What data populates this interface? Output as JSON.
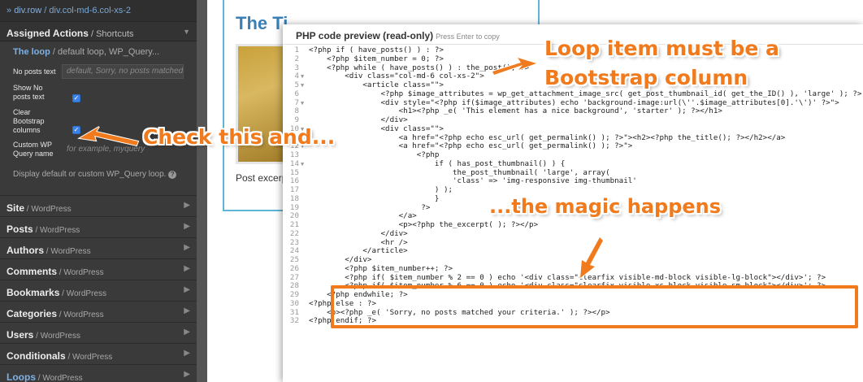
{
  "breadcrumb": {
    "prefix": "» ",
    "crumb1": "div.row",
    "sep": " / ",
    "crumb2": "div.col-md-6.col-xs-2"
  },
  "assigned": {
    "title": "Assigned Actions",
    "subtitle": " / Shortcuts",
    "loop_label": "The loop",
    "loop_desc": " / default loop, WP_Query...",
    "fields": [
      {
        "label": "No posts text",
        "placeholder": "default, Sorry, no posts matched y"
      },
      {
        "label": "Show No posts text",
        "checked": true
      },
      {
        "label": "Clear Bootstrap columns",
        "checked": true
      },
      {
        "label": "Custom WP Query name",
        "placeholder": "for example, myquery"
      }
    ],
    "note": "Display default or custom WP_Query loop.",
    "help_icon": "help-circle-icon"
  },
  "sections": [
    {
      "name": "Site",
      "cat": " / WordPress"
    },
    {
      "name": "Posts",
      "cat": " / WordPress"
    },
    {
      "name": "Authors",
      "cat": " / WordPress"
    },
    {
      "name": "Comments",
      "cat": " / WordPress"
    },
    {
      "name": "Bookmarks",
      "cat": " / WordPress"
    },
    {
      "name": "Categories",
      "cat": " / WordPress"
    },
    {
      "name": "Users",
      "cat": " / WordPress"
    },
    {
      "name": "Conditionals",
      "cat": " / WordPress"
    },
    {
      "name": "Loops",
      "cat": " / WordPress"
    }
  ],
  "background": {
    "title": "The Ti",
    "excerpt": "Post excerpt"
  },
  "dialog": {
    "title": "PHP code preview (read-only)",
    "hint": "Press Enter to copy"
  },
  "code_lines": [
    {
      "n": "1",
      "fold": "",
      "t": "<?php if ( have_posts() ) : ?>"
    },
    {
      "n": "2",
      "fold": "",
      "t": "    <?php $item_number = 0; ?>"
    },
    {
      "n": "3",
      "fold": "",
      "t": "    <?php while ( have_posts() ) : the_post(); ?>"
    },
    {
      "n": "4",
      "fold": "▼",
      "t": "        <div class=\"col-md-6 col-xs-2\">"
    },
    {
      "n": "5",
      "fold": "▼",
      "t": "            <article class=\"\">"
    },
    {
      "n": "6",
      "fold": "",
      "t": "                <?php $image_attributes = wp_get_attachment_image_src( get_post_thumbnail_id( get_the_ID() ), 'large' ); ?>"
    },
    {
      "n": "7",
      "fold": "▼",
      "t": "                <div style=\"<?php if($image_attributes) echo 'background-image:url(\\''.$image_attributes[0].'\\')' ?>\">"
    },
    {
      "n": "8",
      "fold": "",
      "t": "                    <h1><?php _e( 'This element has a nice background', 'starter' ); ?></h1>"
    },
    {
      "n": "9",
      "fold": "",
      "t": "                </div>"
    },
    {
      "n": "10",
      "fold": "▼",
      "t": "                <div class=\"\">"
    },
    {
      "n": "11",
      "fold": "",
      "t": "                    <a href=\"<?php echo esc_url( get_permalink() ); ?>\"><h2><?php the_title(); ?></h2></a>"
    },
    {
      "n": "12",
      "fold": "▼",
      "t": "                    <a href=\"<?php echo esc_url( get_permalink() ); ?>\">"
    },
    {
      "n": "13",
      "fold": "",
      "t": "                        <?php"
    },
    {
      "n": "14",
      "fold": "▼",
      "t": "                            if ( has_post_thumbnail() ) {"
    },
    {
      "n": "15",
      "fold": "",
      "t": "                                the_post_thumbnail( 'large', array("
    },
    {
      "n": "16",
      "fold": "",
      "t": "                                'class' => 'img-responsive img-thumbnail'"
    },
    {
      "n": "17",
      "fold": "",
      "t": "                            ) );"
    },
    {
      "n": "18",
      "fold": "",
      "t": "                            }"
    },
    {
      "n": "19",
      "fold": "",
      "t": "                         ?>"
    },
    {
      "n": "20",
      "fold": "",
      "t": "                    </a>"
    },
    {
      "n": "21",
      "fold": "",
      "t": "                    <p><?php the_excerpt( ); ?></p>"
    },
    {
      "n": "22",
      "fold": "",
      "t": "                </div>"
    },
    {
      "n": "23",
      "fold": "",
      "t": "                <hr />"
    },
    {
      "n": "24",
      "fold": "",
      "t": "            </article>"
    },
    {
      "n": "25",
      "fold": "",
      "t": "        </div>"
    },
    {
      "n": "26",
      "fold": "",
      "t": "        <?php $item_number++; ?>"
    },
    {
      "n": "27",
      "fold": "",
      "t": "        <?php if( $item_number % 2 == 0 ) echo '<div class=\"clearfix visible-md-block visible-lg-block\"></div>'; ?>"
    },
    {
      "n": "28",
      "fold": "",
      "t": "        <?php if( $item_number % 6 == 0 ) echo '<div class=\"clearfix visible-xs-block visible-sm-block\"></div>'; ?>"
    },
    {
      "n": "29",
      "fold": "",
      "t": "    <?php endwhile; ?>"
    },
    {
      "n": "30",
      "fold": "",
      "t": "<?php else : ?>"
    },
    {
      "n": "31",
      "fold": "",
      "t": "    <p><?php _e( 'Sorry, no posts matched your criteria.' ); ?></p>"
    },
    {
      "n": "32",
      "fold": "",
      "t": "<?php endif; ?>"
    }
  ],
  "callouts": {
    "loop_line1": "Loop item must be a",
    "loop_line2": "Bootstrap column",
    "check": "Check this and...",
    "magic": "...the magic happens"
  },
  "colors": {
    "annotation": "#f07a1c",
    "checkbox": "#3b82e6",
    "panel": "#3a3a3a"
  }
}
